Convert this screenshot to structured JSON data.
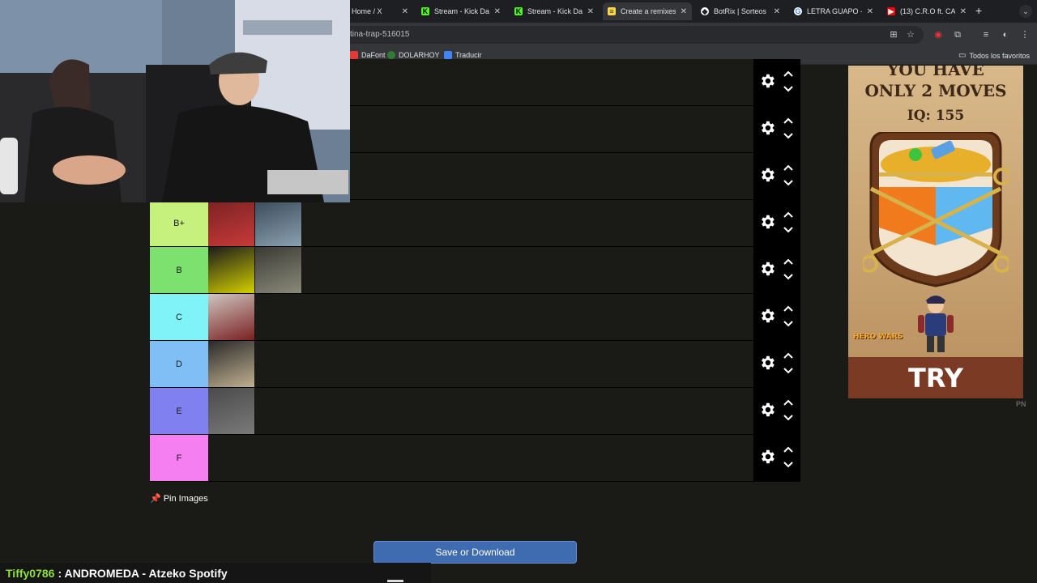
{
  "browser": {
    "tabs": [
      {
        "title": "Home / X",
        "favicon": "x-icon",
        "active": false
      },
      {
        "title": "Stream - Kick Da",
        "favicon": "kick-icon",
        "active": false
      },
      {
        "title": "Stream - Kick Da",
        "favicon": "kick-icon",
        "active": false
      },
      {
        "title": "Create a remixes",
        "favicon": "tiermaker-icon",
        "active": true
      },
      {
        "title": "BotRix | Sorteos",
        "favicon": "botrix-icon",
        "active": false
      },
      {
        "title": "LETRA GUAPO - L",
        "favicon": "google-icon",
        "active": false
      },
      {
        "title": "(13) C.R.O ft. CA",
        "favicon": "youtube-icon",
        "active": false
      }
    ],
    "new_tab": "+",
    "url": "tina-trap-516015",
    "bookmarks": [
      {
        "label": "DaFont",
        "icon": "dafont-icon"
      },
      {
        "label": "DOLARHOY",
        "icon": "dolarhoy-icon"
      },
      {
        "label": "Traducir",
        "icon": "translate-icon"
      }
    ],
    "all_bookmarks": "Todos los favoritos"
  },
  "tiers": [
    {
      "label": "",
      "color": "#1a1a17",
      "items": 1
    },
    {
      "label": "",
      "color": "#1a1a17",
      "items": 0
    },
    {
      "label": "",
      "color": "#1a1a17",
      "items": 0
    },
    {
      "label": "B+",
      "color": "#c6f17d",
      "items": 2
    },
    {
      "label": "B",
      "color": "#7de16f",
      "items": 2
    },
    {
      "label": "C",
      "color": "#7ff3f8",
      "items": 1
    },
    {
      "label": "D",
      "color": "#7fbff5",
      "items": 1
    },
    {
      "label": "E",
      "color": "#8080f0",
      "items": 1
    },
    {
      "label": "F",
      "color": "#f57ff0",
      "items": 0
    }
  ],
  "pin_images_label": "Pin Images",
  "save_button_label": "Save or Download",
  "ad": {
    "headline_1": "YOU HAVE",
    "headline_2": "ONLY 2 MOVES",
    "iq": "IQ: 155",
    "brand": "HERO WARS",
    "cta": "TRY",
    "tag": "PN"
  },
  "chat": {
    "user": "Tiffy0786",
    "message": ": ANDROMEDA - Atzeko Spotify"
  }
}
